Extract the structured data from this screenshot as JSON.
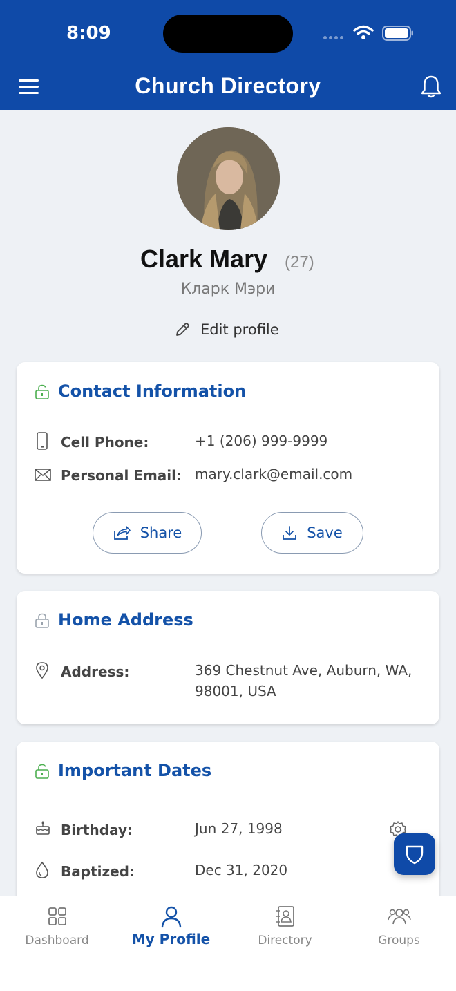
{
  "status_bar": {
    "time": "8:09"
  },
  "header": {
    "title": "Church Directory"
  },
  "profile": {
    "name": "Clark Mary",
    "age": "(27)",
    "alt_name": "Кларк Мэри",
    "edit_label": "Edit profile"
  },
  "contact": {
    "title": "Contact Information",
    "rows": [
      {
        "label": "Cell Phone:",
        "value": "+1 (206) 999-9999"
      },
      {
        "label": "Personal Email:",
        "value": "mary.clark@email.com"
      }
    ],
    "share_label": "Share",
    "save_label": "Save"
  },
  "address": {
    "title": "Home Address",
    "label": "Address:",
    "line1": "369 Chestnut Ave, Auburn, WA,",
    "line2": "98001, USA"
  },
  "dates": {
    "title": "Important Dates",
    "rows": [
      {
        "label": "Birthday:",
        "value": "Jun 27, 1998"
      },
      {
        "label": "Baptized:",
        "value": "Dec 31, 2020"
      }
    ]
  },
  "nav": {
    "items": [
      {
        "label": "Dashboard",
        "icon": "grid-icon"
      },
      {
        "label": "My Profile",
        "icon": "person-icon"
      },
      {
        "label": "Directory",
        "icon": "contacts-book-icon"
      },
      {
        "label": "Groups",
        "icon": "group-icon"
      }
    ],
    "active_index": 1
  },
  "colors": {
    "brand": "#0f4aa8",
    "accent_text": "#1452a8",
    "lock_green": "#4caf50",
    "lock_gray": "#9aa3ad"
  }
}
